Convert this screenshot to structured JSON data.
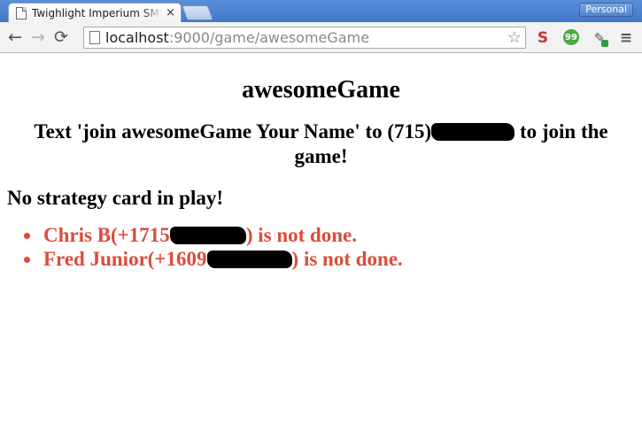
{
  "browser": {
    "tab_title": "Twighlight Imperium SMS",
    "tab_close": "×",
    "profile_label": "Personal",
    "url_host": "localhost",
    "url_rest": ":9000/game/awesomeGame",
    "nav": {
      "back": "←",
      "forward": "→",
      "reload": "⟳"
    },
    "star": "☆",
    "ext_chat_label": "99",
    "menu_glyph": "≡"
  },
  "page": {
    "title": "awesomeGame",
    "instruction_before": "Text 'join awesomeGame Your Name' to (715)",
    "instruction_after": " to join the game!",
    "status": "No strategy card in play!",
    "players": [
      {
        "name_prefix": "Chris B(+1715",
        "suffix": ") is not done."
      },
      {
        "name_prefix": "Fred Junior(+1609",
        "suffix": ") is not done."
      }
    ]
  },
  "colors": {
    "player_status": "#dd4b39",
    "tabstrip": "#4a83d0"
  }
}
